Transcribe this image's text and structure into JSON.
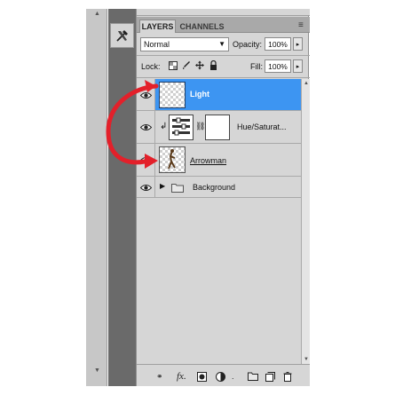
{
  "panel": {
    "tabs": [
      {
        "label": "LAYERS"
      },
      {
        "label": "CHANNELS"
      }
    ],
    "menu_icon": "panel-menu-icon",
    "blend_mode": "Normal",
    "opacity_label": "Opacity:",
    "opacity_value": "100%",
    "lock_label": "Lock:",
    "fill_label": "Fill:",
    "fill_value": "100%",
    "lock_icons": [
      "lock-transparency-icon",
      "lock-paint-icon",
      "lock-position-icon",
      "lock-all-icon"
    ]
  },
  "layers": [
    {
      "name": "Light",
      "selected": true,
      "visible": true,
      "type": "pixel"
    },
    {
      "name": "Hue/Saturat...",
      "selected": false,
      "visible": true,
      "type": "adjustment",
      "clipped": true
    },
    {
      "name": "Arrowman",
      "selected": false,
      "visible": true,
      "type": "pixel"
    },
    {
      "name": "Background",
      "selected": false,
      "visible": true,
      "type": "group"
    }
  ],
  "bottom_icons": [
    "link-icon",
    "fx-icon",
    "mask-icon",
    "adjustment-icon",
    "folder-icon",
    "new-layer-icon",
    "trash-icon"
  ],
  "bottom_labels": {
    "fx": "fx."
  },
  "colors": {
    "selected_row": "#3d95f2",
    "annotation_arrow": "#e3202a",
    "panel_bg": "#d6d6d6",
    "dock_bg": "#6a6a6a"
  },
  "annotation": {
    "type": "curved-arrow",
    "from": "Light",
    "to": "Arrowman"
  }
}
